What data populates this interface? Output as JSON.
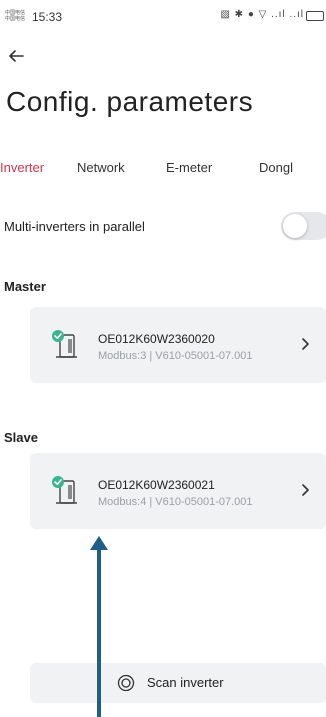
{
  "status_bar": {
    "carrier_line1": "中国电信",
    "carrier_line2": "中国电信",
    "time": "15:33",
    "icons": "▧ ✱ ● ▽ ..ıl ..ıl"
  },
  "header": {
    "back_icon": "arrow-left-icon",
    "title": "Config. parameters"
  },
  "tabs": [
    {
      "label": "Inverter",
      "active": true
    },
    {
      "label": "Network",
      "active": false
    },
    {
      "label": "E-meter",
      "active": false
    },
    {
      "label": "Dongl",
      "active": false
    }
  ],
  "parallel": {
    "label": "Multi-inverters in parallel",
    "enabled": false
  },
  "master": {
    "section_label": "Master",
    "serial": "OE012K60W2360020",
    "meta": "Modbus:3 | V610-05001-07.001",
    "icon": "inverter-connected-icon"
  },
  "slave": {
    "section_label": "Slave",
    "serial": "OE012K60W2360021",
    "meta": "Modbus:4 | V610-05001-07.001",
    "icon": "inverter-connected-icon"
  },
  "scan": {
    "label": "Scan inverter",
    "icon": "scan-icon"
  },
  "annotation": {
    "icon": "annotation-arrow-up",
    "color": "#1f5f86"
  },
  "colors": {
    "accent": "#d8344a",
    "card_bg": "#f0f2f4",
    "check_green": "#3bb58f"
  }
}
